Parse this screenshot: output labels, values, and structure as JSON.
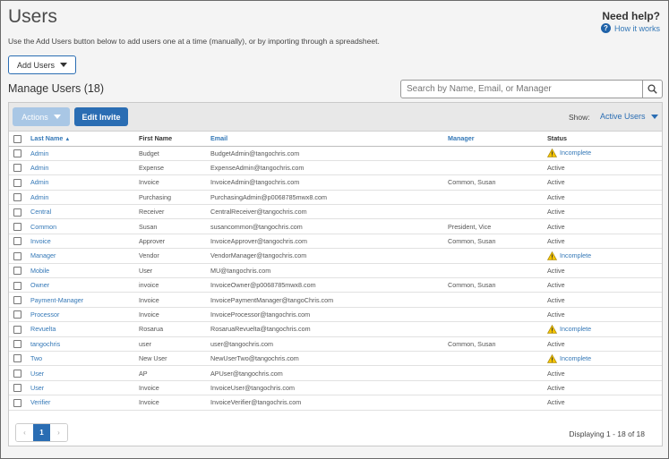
{
  "header": {
    "title": "Users",
    "help_title": "Need help?",
    "help_link": "How it works",
    "intro": "Use the Add Users button below to add users one at a time (manually), or by importing through a spreadsheet.",
    "add_users_label": "Add Users"
  },
  "manage": {
    "title": "Manage Users (18)",
    "search_placeholder": "Search by Name, Email, or Manager"
  },
  "toolbar": {
    "actions_label": "Actions",
    "edit_invite_label": "Edit Invite",
    "show_label": "Show:",
    "show_value": "Active Users"
  },
  "table": {
    "headers": {
      "last_name": "Last Name",
      "first_name": "First Name",
      "email": "Email",
      "manager": "Manager",
      "status": "Status"
    },
    "rows": [
      {
        "last": "Admin",
        "first": "Budget",
        "email": "BudgetAdmin@tangochris.com",
        "manager": "",
        "status": "Incomplete"
      },
      {
        "last": "Admin",
        "first": "Expense",
        "email": "ExpenseAdmin@tangochris.com",
        "manager": "",
        "status": "Active"
      },
      {
        "last": "Admin",
        "first": "Invoice",
        "email": "InvoiceAdmin@tangochris.com",
        "manager": "Common, Susan",
        "status": "Active"
      },
      {
        "last": "Admin",
        "first": "Purchasing",
        "email": "PurchasingAdmin@p0068785mwx8.com",
        "manager": "",
        "status": "Active"
      },
      {
        "last": "Central",
        "first": "Receiver",
        "email": "CentralReceiver@tangochris.com",
        "manager": "",
        "status": "Active"
      },
      {
        "last": "Common",
        "first": "Susan",
        "email": "susancommon@tangochris.com",
        "manager": "President, Vice",
        "status": "Active"
      },
      {
        "last": "Invoice",
        "first": "Approver",
        "email": "InvoiceApprover@tangochris.com",
        "manager": "Common, Susan",
        "status": "Active"
      },
      {
        "last": "Manager",
        "first": "Vendor",
        "email": "VendorManager@tangochris.com",
        "manager": "",
        "status": "Incomplete"
      },
      {
        "last": "Mobile",
        "first": "User",
        "email": "MU@tangochris.com",
        "manager": "",
        "status": "Active"
      },
      {
        "last": "Owner",
        "first": "invoice",
        "email": "InvoiceOwner@p0068785mwx8.com",
        "manager": "Common, Susan",
        "status": "Active"
      },
      {
        "last": "Payment-Manager",
        "first": "Invoice",
        "email": "InvoicePaymentManager@tangoChris.com",
        "manager": "",
        "status": "Active"
      },
      {
        "last": "Processor",
        "first": "Invoice",
        "email": "InvoiceProcessor@tangochris.com",
        "manager": "",
        "status": "Active"
      },
      {
        "last": "Revuelta",
        "first": "Rosarua",
        "email": "RosaruaRevuelta@tangochris.com",
        "manager": "",
        "status": "Incomplete"
      },
      {
        "last": "tangochris",
        "first": "user",
        "email": "user@tangochris.com",
        "manager": "Common, Susan",
        "status": "Active"
      },
      {
        "last": "Two",
        "first": "New User",
        "email": "NewUserTwo@tangochris.com",
        "manager": "",
        "status": "Incomplete"
      },
      {
        "last": "User",
        "first": "AP",
        "email": "APUser@tangochris.com",
        "manager": "",
        "status": "Active"
      },
      {
        "last": "User",
        "first": "Invoice",
        "email": "InvoiceUser@tangochris.com",
        "manager": "",
        "status": "Active"
      },
      {
        "last": "Verifier",
        "first": "Invoice",
        "email": "InvoiceVerifier@tangochris.com",
        "manager": "",
        "status": "Active"
      }
    ]
  },
  "pagination": {
    "prev": "‹",
    "current": "1",
    "next": "›",
    "displaying": "Displaying 1 - 18 of 18"
  },
  "icons": {
    "help": "question-circle-icon",
    "search": "search-icon",
    "warning": "warning-triangle-icon",
    "sort": "sort-ascending-icon"
  },
  "colors": {
    "primary": "#2a6db3",
    "link": "#3478b7",
    "warning": "#f2c200"
  }
}
